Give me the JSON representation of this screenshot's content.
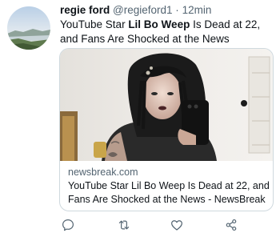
{
  "tweet": {
    "author_name": "regie ford",
    "handle": "@regieford1",
    "separator": "·",
    "time": "12min",
    "text_prefix": "YouTube Star ",
    "text_bold": "Lil Bo Weep",
    "text_suffix": " Is Dead at 22, and Fans Are Shocked at the News"
  },
  "card": {
    "domain": "newsbreak.com",
    "title": "YouTube Star Lil Bo Weep Is Dead at 22, and Fans Are Shocked at the News - NewsBreak"
  },
  "actions": [
    {
      "icon": "reply-icon"
    },
    {
      "icon": "retweet-icon"
    },
    {
      "icon": "like-icon"
    },
    {
      "icon": "share-icon"
    }
  ],
  "colors": {
    "text_primary": "#0f1419",
    "text_secondary": "#536471",
    "border": "#cfd9de"
  }
}
